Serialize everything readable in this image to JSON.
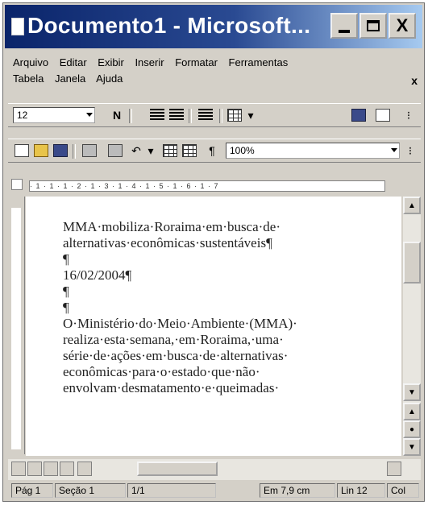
{
  "window": {
    "title": "Documento1 - Microsoft...",
    "min_label": "",
    "max_label": "",
    "close_label": "X"
  },
  "menu": {
    "row1": [
      "Arquivo",
      "Editar",
      "Exibir",
      "Inserir",
      "Formatar",
      "Ferramentas"
    ],
    "row2": [
      "Tabela",
      "Janela",
      "Ajuda"
    ],
    "close": "x"
  },
  "toolbar1": {
    "font_size": "12",
    "bold": "N",
    "zoom_label": ""
  },
  "toolbar2": {
    "paragraph": "¶",
    "zoom": "100%"
  },
  "ruler": {
    "scale": "· 1 · 1 · 1 · 2 · 1 · 3 · 1 · 4 · 1 · 5 · 1 · 6 · 1 · 7"
  },
  "document": {
    "lines": [
      "MMA·mobiliza·Roraima·em·busca·de·",
      "alternativas·econômicas·sustentáveis¶",
      "¶",
      "16/02/2004¶",
      "¶",
      "¶",
      "O·Ministério·do·Meio·Ambiente·(MMA)·",
      "realiza·esta·semana,·em·Roraima,·uma·",
      "série·de·ações·em·busca·de·alternativas·",
      "econômicas·para·o·estado·que·não·",
      "envolvam·desmatamento·e·queimadas·"
    ]
  },
  "statusbar": {
    "page": "Pág 1",
    "section": "Seção 1",
    "pages": "1/1",
    "position": "Em 7,9 cm",
    "line": "Lin 12",
    "column": "Col"
  },
  "colors": {
    "title_gradient_start": "#0a246a",
    "title_gradient_end": "#a6caf0",
    "chrome": "#d4d0c8"
  }
}
